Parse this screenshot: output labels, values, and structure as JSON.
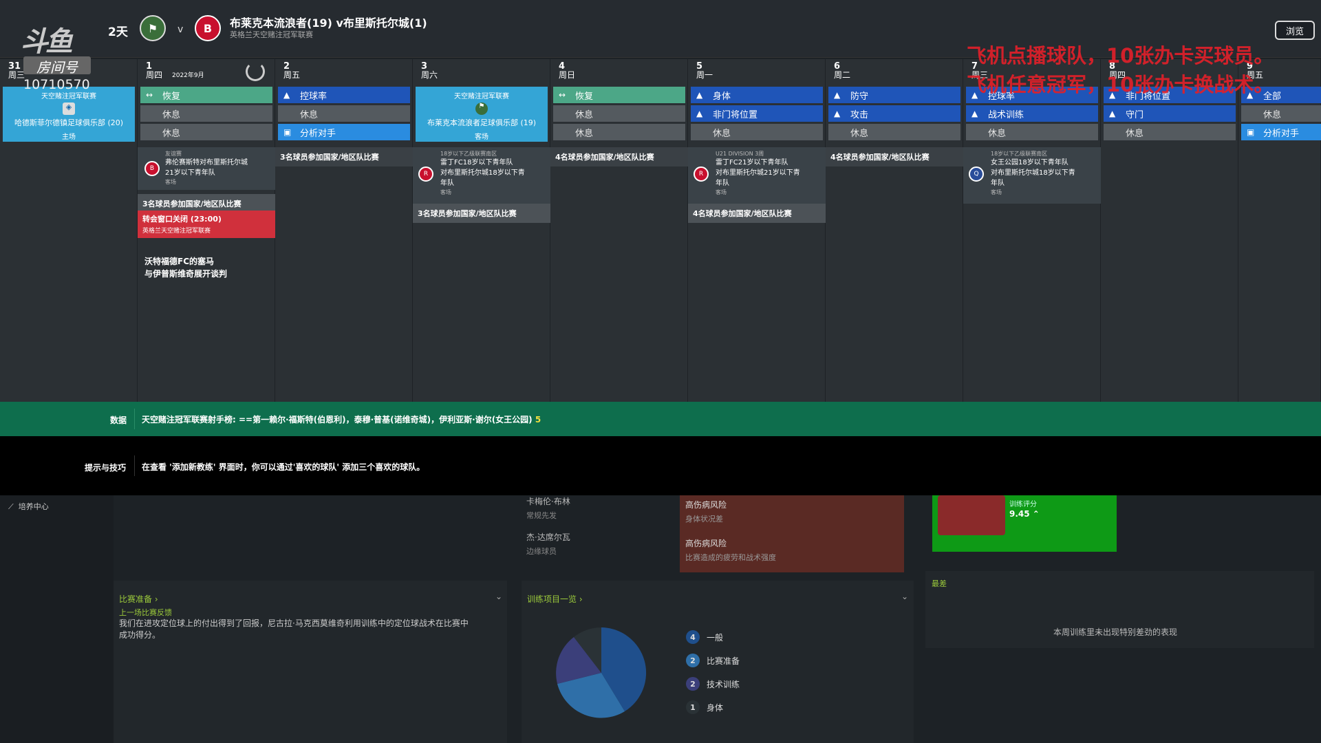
{
  "header": {
    "days": "2天",
    "vs": "v",
    "match_title": "布莱克本流浪者(19) v布里斯托尔城(1)",
    "match_subtitle": "英格兰天空赌注冠军联赛",
    "browse_label": "浏览"
  },
  "stream": {
    "logo": "斗鱼",
    "room_label": "房间号",
    "room_number": "10710570",
    "overlay_line1": "飞机点播球队，10张办卡买球员。",
    "overlay_line2": "飞机任意冠军，10张办卡换战术。"
  },
  "calendar": {
    "month": "2022年9月",
    "days": [
      {
        "num": "31",
        "dow": "周三"
      },
      {
        "num": "1",
        "dow": "周四"
      },
      {
        "num": "2",
        "dow": "周五"
      },
      {
        "num": "3",
        "dow": "周六"
      },
      {
        "num": "4",
        "dow": "周日"
      },
      {
        "num": "5",
        "dow": "周一"
      },
      {
        "num": "6",
        "dow": "周二"
      },
      {
        "num": "7",
        "dow": "周三"
      },
      {
        "num": "8",
        "dow": "周四"
      },
      {
        "num": "9",
        "dow": "周五"
      }
    ],
    "day31": {
      "comp": "天空赌注冠军联赛",
      "team": "哈德斯菲尔德镇足球俱乐部 (20)",
      "venue": "主场"
    },
    "day1": {
      "slots": [
        "恢复",
        "休息",
        "休息"
      ],
      "ev1_type": "友谊赛",
      "ev1_line1": "弗伦赛斯特对布里斯托尔城",
      "ev1_line2": "21岁以下青年队",
      "ev1_venue": "客场",
      "ev2": "3名球员参加国家/地区队比赛",
      "ev3_title": "转会窗口关闭 (23:00)",
      "ev3_sub": "英格兰天空赌注冠军联赛",
      "news1": "沃特福德FC的塞马",
      "news2": "与伊普斯维奇展开谈判"
    },
    "day2": {
      "slots": [
        "控球率",
        "休息",
        "分析对手"
      ],
      "ev1": "3名球员参加国家/地区队比赛"
    },
    "day3": {
      "comp": "天空赌注冠军联赛",
      "team": "布莱克本流浪者足球俱乐部 (19)",
      "venue": "客场",
      "ev1_type": "18岁以下乙级联赛南区",
      "ev1_line1": "雷丁FC18岁以下青年队",
      "ev1_line2": "对布里斯托尔城18岁以下青",
      "ev1_line3": "年队",
      "ev1_venue": "客场",
      "ev2": "3名球员参加国家/地区队比赛"
    },
    "day4": {
      "slots": [
        "恢复",
        "休息",
        "休息"
      ],
      "ev1": "4名球员参加国家/地区队比赛"
    },
    "day5": {
      "slots": [
        "身体",
        "非门将位置",
        "休息"
      ],
      "ev1_type": "U21 DIVISION 3周",
      "ev1_line1": "雷丁FC21岁以下青年队",
      "ev1_line2": "对布里斯托尔城21岁以下青",
      "ev1_line3": "年队",
      "ev1_venue": "客场",
      "ev2": "4名球员参加国家/地区队比赛"
    },
    "day6": {
      "slots": [
        "防守",
        "攻击",
        "休息"
      ],
      "ev1": "4名球员参加国家/地区队比赛"
    },
    "day7": {
      "slots": [
        "控球率",
        "战术训练",
        "休息"
      ],
      "ev1_type": "18岁以下乙级联赛南区",
      "ev1_line1": "女王公园18岁以下青年队",
      "ev1_line2": "对布里斯托尔城18岁以下青",
      "ev1_line3": "年队",
      "ev1_venue": "客场"
    },
    "day8": {
      "slots": [
        "非门将位置",
        "守门",
        "休息"
      ]
    },
    "day9": {
      "slots": [
        "全部",
        "休息",
        "分析对手"
      ]
    }
  },
  "databar": {
    "label": "数据",
    "text": "天空赌注冠军联赛射手榜: ==第一赖尔·福斯特(伯恩利)，泰穆·普基(诺维奇城)，伊利亚斯·谢尔(女王公园)",
    "count": "5"
  },
  "tipbar": {
    "label": "提示与技巧",
    "text": "在查看 '添加新教练' 界面时，你可以通过'喜欢的球队' 添加三个喜欢的球队。"
  },
  "lower": {
    "sidebar_item": "培养中心",
    "player1_name": "卡梅伦·布林",
    "player1_role": "常规先发",
    "risk1_title": "高伤病风险",
    "risk1_sub": "身体状况差",
    "player2_name": "杰·达席尔瓦",
    "player2_role": "边缘球员",
    "risk2_title": "高伤病风险",
    "risk2_sub": "比赛造成的疲劳和战术强度",
    "rating_label": "训练评分",
    "rating_value": "9.45",
    "prep_header": "比赛准备 ›",
    "prep_sub": "上一场比赛反馈",
    "prep_text1": "我们在进攻定位球上的付出得到了回报，尼古拉·马克西莫维奇利用训练中的定位球战术在比赛中",
    "prep_text2": "成功得分。",
    "training_header": "训练项目一览 ›",
    "worst_header": "最差",
    "worst_text": "本周训练里未出现特别差劲的表现",
    "legend": [
      {
        "n": "4",
        "label": "一般",
        "color": "#1f4f8c"
      },
      {
        "n": "2",
        "label": "比赛准备",
        "color": "#2f6fa8"
      },
      {
        "n": "2",
        "label": "技术训练",
        "color": "#3b3f7a"
      },
      {
        "n": "1",
        "label": "身体",
        "color": "#2a3236"
      }
    ]
  }
}
